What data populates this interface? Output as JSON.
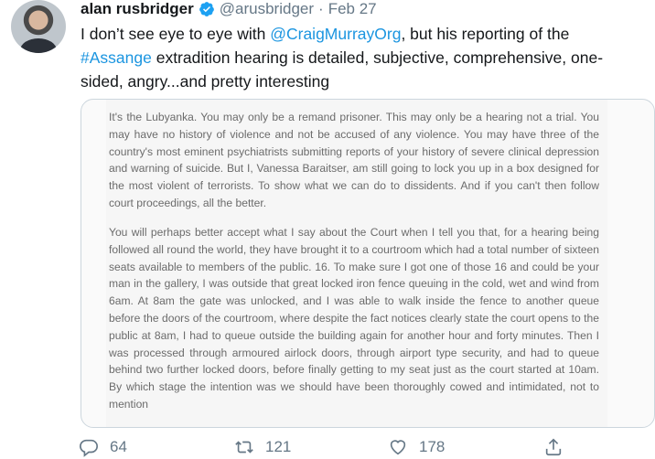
{
  "tweet": {
    "author_name": "alan rusbridger",
    "handle": "@arusbridger",
    "separator": "·",
    "date": "Feb 27",
    "text_before_mention": "I don’t see eye to eye with ",
    "mention": "@CraigMurrayOrg",
    "text_after_mention": ", but his reporting of the ",
    "hashtag": "#Assange",
    "text_after_hashtag": " extradition hearing is detailed, subjective, comprehensive, one-sided, angry...and pretty interesting"
  },
  "media": {
    "paragraph_1": "It's the Lubyanka. You may only be a remand prisoner. This may only be a hearing not a trial. You may have no history of violence and not be accused of any violence. You may have three of the country's most eminent psychiatrists submitting reports of your history of severe clinical depression and warning of suicide. But I, Vanessa Baraitser, am still going to lock you up in a box designed for the most violent of terrorists. To show what we can do to dissidents. And if you can't then follow court proceedings, all the better.",
    "paragraph_2": "You will perhaps better accept what I say about the Court when I tell you that, for a hearing being followed all round the world, they have brought it to a courtroom which had a total number of sixteen seats available to members of the public. 16. To make sure I got one of those 16 and could be your man in the gallery, I was outside that great locked iron fence queuing in the cold, wet and wind from 6am. At 8am the gate was unlocked, and I was able to walk inside the fence to another queue before the doors of the courtroom, where despite the fact notices clearly state the court opens to the public at 8am, I had to queue outside the building again for another hour and forty minutes. Then I was processed through armoured airlock doors, through airport type security, and had to queue behind two further locked doors, before finally getting to my seat just as the court started at 10am. By which stage the intention was we should have been thoroughly cowed and intimidated, not to mention"
  },
  "actions": {
    "reply_count": "64",
    "retweet_count": "121",
    "like_count": "178",
    "icons": [
      "reply-icon",
      "retweet-icon",
      "like-icon",
      "share-icon"
    ]
  },
  "colors": {
    "link": "#1b95e0",
    "verified": "#1da1f2",
    "muted": "#657786"
  }
}
